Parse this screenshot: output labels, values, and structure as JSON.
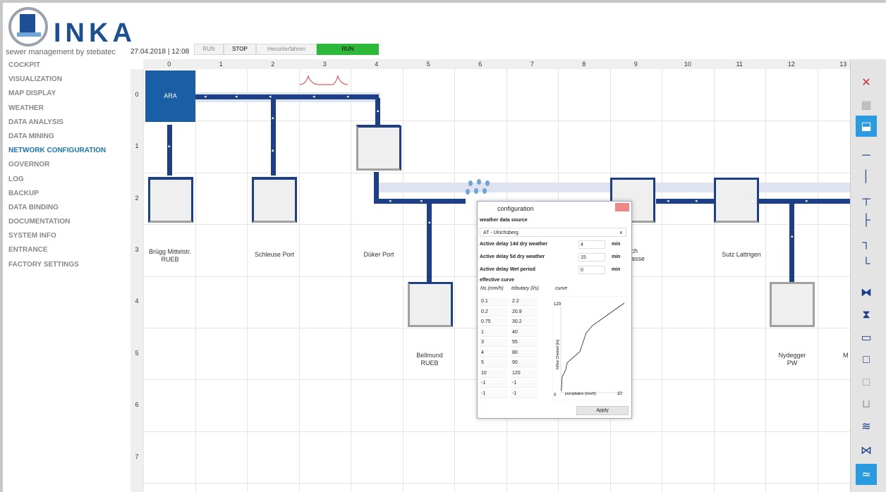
{
  "header": {
    "app_name": "INKA",
    "tagline": "sewer management by stebatec",
    "datetime": "27.04.2018 | 12:08",
    "controls": {
      "run": "RUN",
      "stop": "STOP",
      "shutdown": "Herunterfahren",
      "status": "RUN"
    }
  },
  "nav": {
    "items": [
      {
        "label": "COCKPIT"
      },
      {
        "label": "VISUALIZATION"
      },
      {
        "label": "MAP DISPLAY"
      },
      {
        "label": "WEATHER"
      },
      {
        "label": "DATA ANALYSIS"
      },
      {
        "label": "DATA MINING"
      },
      {
        "label": "NETWORK CONFIGURATION",
        "active": true
      },
      {
        "label": "GOVERNOR"
      },
      {
        "label": "LOG"
      },
      {
        "label": "BACKUP"
      },
      {
        "label": "DATA BINDING"
      },
      {
        "label": "DOCUMENTATION"
      },
      {
        "label": "SYSTEM INFO"
      },
      {
        "label": "ENTRANCE"
      },
      {
        "label": "FACTORY SETTINGS"
      }
    ]
  },
  "grid": {
    "columns": [
      "0",
      "1",
      "2",
      "3",
      "4",
      "5",
      "6",
      "7",
      "8",
      "9",
      "10",
      "11",
      "12",
      "13"
    ],
    "rows": [
      "0",
      "1",
      "2",
      "3",
      "4",
      "5",
      "6",
      "7"
    ],
    "labels": {
      "ara": "ARA",
      "brugg1": "Brügg Mittelstr.",
      "brugg2": "RUEB",
      "schleuse": "Schleuse Port",
      "duker": "Düker Port",
      "bellmund1": "Bellmund",
      "bellmund2": "RUEB",
      "sach1": "sach",
      "sach2": "strasse",
      "sutz": "Sutz Lattrigen",
      "nydegger1": "Nydegger",
      "nydegger2": "PW",
      "edge_m": "M"
    }
  },
  "dialog": {
    "title": "configuration",
    "source_label": "weather data source",
    "source_value": "AT - Ulrichsberg",
    "params": [
      {
        "label": "Active delay 14d dry weather",
        "value": "4",
        "unit": "min"
      },
      {
        "label": "Active delay 5d dry weather",
        "value": "15",
        "unit": "min"
      },
      {
        "label": "Active delay Wet period",
        "value": "0",
        "unit": "min"
      }
    ],
    "curve_label": "effective curve",
    "col_ns": "Ns.(mm/h)",
    "col_trib": "tributary (l/s)",
    "col_curve": "curve",
    "table": [
      [
        "0.1",
        "2.2"
      ],
      [
        "0.2",
        "20.9"
      ],
      [
        "0.75",
        "30.2"
      ],
      [
        "1",
        "40"
      ],
      [
        "3",
        "55"
      ],
      [
        "4",
        "80"
      ],
      [
        "5",
        "90"
      ],
      [
        "10",
        "120"
      ],
      [
        "-1",
        "-1"
      ],
      [
        "-1",
        "-1"
      ]
    ],
    "chart": {
      "ymax": "120",
      "ymin": "0",
      "ylabel": "Inflow Channel [l/s]",
      "xlabel": "precipitation [mm/h]",
      "xmax": "10"
    },
    "apply": "Apply"
  }
}
